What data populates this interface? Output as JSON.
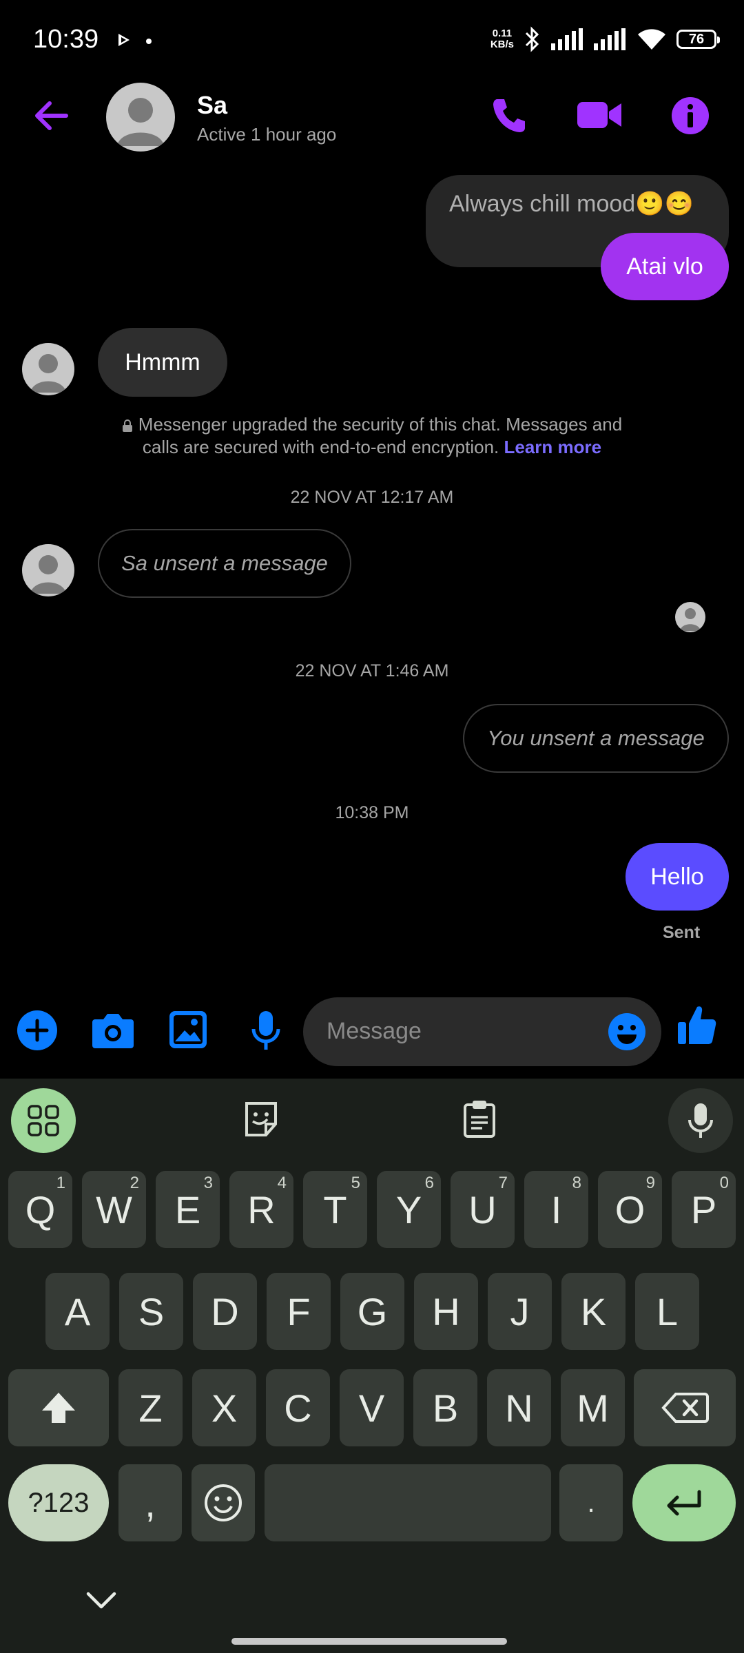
{
  "status_bar": {
    "time": "10:39",
    "net_speed_top": "0.11",
    "net_speed_unit": "KB/s",
    "battery": "76"
  },
  "header": {
    "name": "Sa",
    "status": "Active 1 hour ago"
  },
  "messages": {
    "m1": "Always chill mood🙂😊",
    "m2": "Atai vlo",
    "m3": "Hmmm",
    "security_text": "Messenger upgraded the security of this chat. Messages and calls are secured with end-to-end encryption.",
    "learn_more": "Learn more",
    "ts1": "22 NOV AT 12:17 AM",
    "unsent_them": "Sa unsent a message",
    "ts2": "22 NOV AT 1:46 AM",
    "unsent_you": "You unsent a message",
    "ts3": "10:38 PM",
    "m4": "Hello",
    "sent_status": "Sent"
  },
  "composer": {
    "placeholder": "Message"
  },
  "keyboard": {
    "row1": [
      "Q",
      "W",
      "E",
      "R",
      "T",
      "Y",
      "U",
      "I",
      "O",
      "P"
    ],
    "row1_sup": [
      "1",
      "2",
      "3",
      "4",
      "5",
      "6",
      "7",
      "8",
      "9",
      "0"
    ],
    "row2": [
      "A",
      "S",
      "D",
      "F",
      "G",
      "H",
      "J",
      "K",
      "L"
    ],
    "row3": [
      "Z",
      "X",
      "C",
      "V",
      "B",
      "N",
      "M"
    ],
    "sym": "?123",
    "comma": ",",
    "period": "."
  },
  "colors": {
    "accent": "#a033ff",
    "blue": "#0a7cff",
    "sent_bubble": "#5b4cff",
    "gradient_bubble": "#a233f0",
    "key_green": "#9fd89a"
  }
}
